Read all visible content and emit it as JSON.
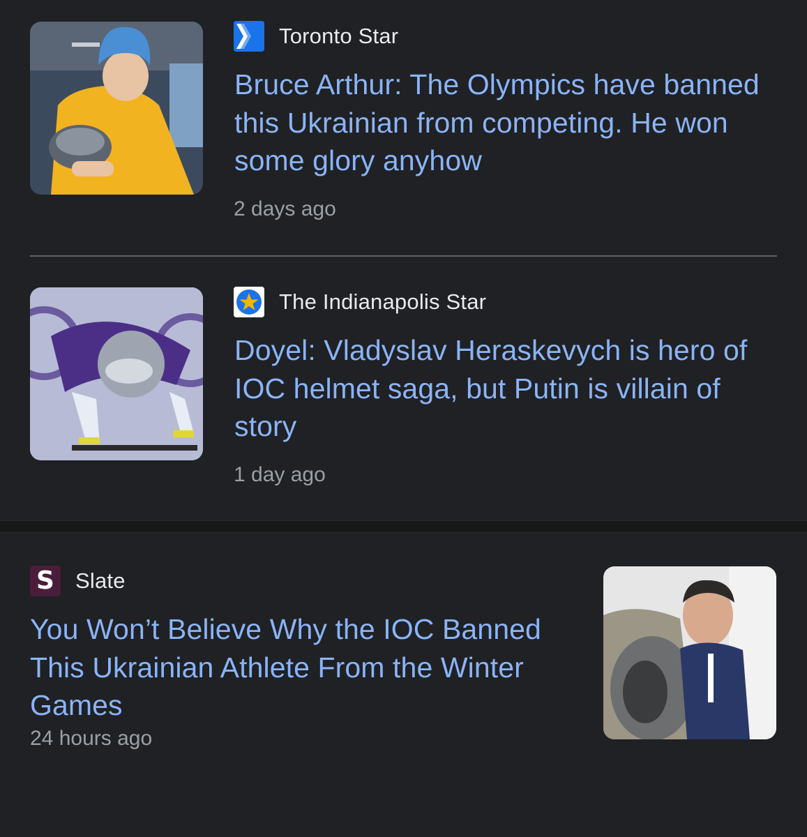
{
  "articles": [
    {
      "source": "Toronto Star",
      "source_logo": "toronto-star-logo",
      "source_color": "#1a73e8",
      "headline": "Bruce Arthur: The Olympics have banned this Ukrainian from competing. He won some glory anyhow",
      "time": "2 days ago"
    },
    {
      "source": "The Indianapolis Star",
      "source_logo": "indystar-logo",
      "source_color": "#f4b400",
      "headline": "Doyel: Vladyslav Heraskevych is hero of IOC helmet saga, but Putin is villain of story",
      "time": "1 day ago"
    },
    {
      "source": "Slate",
      "source_logo": "slate-logo",
      "source_color": "#4a1d3a",
      "source_logo_letter": "S",
      "headline": "You Won’t Believe Why the IOC Banned This Ukrainian Athlete From the Winter Games",
      "time": "24 hours ago"
    }
  ],
  "colors": {
    "background": "#202124",
    "headline": "#8ab4f8",
    "source_text": "#e8eaed",
    "time_text": "#9aa0a6",
    "divider": "#5f6368"
  }
}
